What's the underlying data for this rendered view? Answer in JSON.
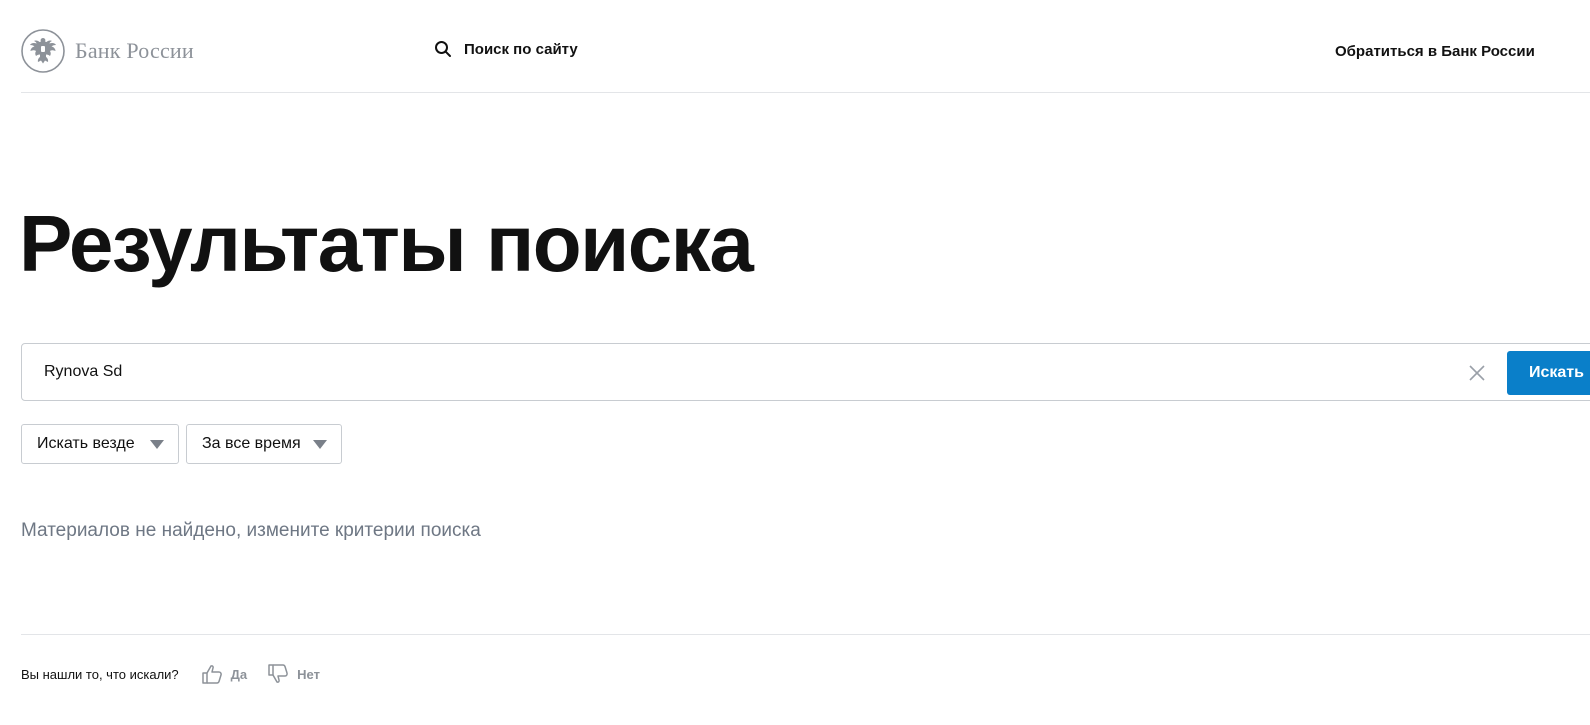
{
  "header": {
    "logo_text": "Банк России",
    "site_search_label": "Поиск по сайту",
    "contact_label": "Обратиться в Банк России"
  },
  "main": {
    "title": "Результаты поиска",
    "search": {
      "value": "Rynova Sd",
      "button_label": "Искать"
    },
    "filters": {
      "where": "Искать везде",
      "time": "За все время"
    },
    "empty_message": "Материалов не найдено, измените критерии поиска"
  },
  "feedback": {
    "question": "Вы нашли то, что искали?",
    "yes_label": "Да",
    "no_label": "Нет"
  },
  "colors": {
    "accent": "#0a7fc9",
    "muted_text": "#6e7784",
    "border": "#c8ccd1"
  }
}
